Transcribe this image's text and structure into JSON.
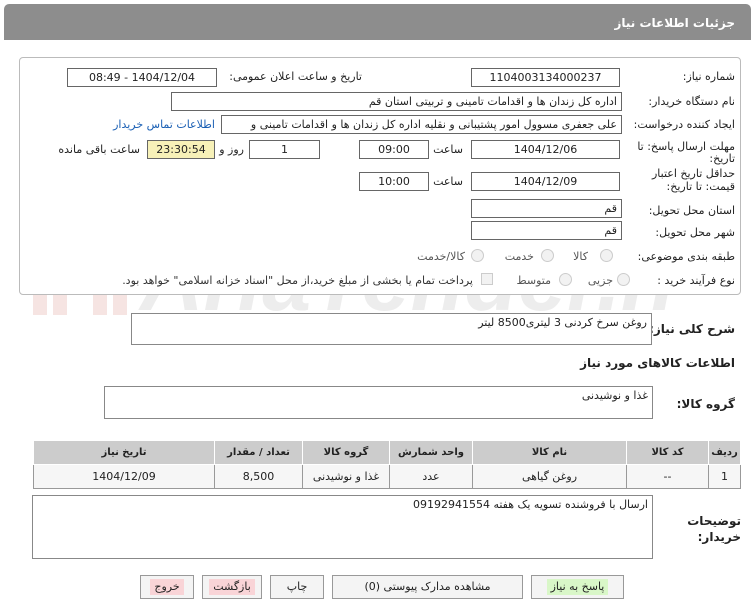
{
  "header": {
    "title": "جزئیات اطلاعات نیاز"
  },
  "form": {
    "need_number_label": "شماره نیاز:",
    "need_number": "1104003134000237",
    "announce_label": "تاریخ و ساعت اعلان عمومی:",
    "announce_value": "1404/12/04 - 08:49",
    "buyer_org_label": "نام دستگاه خریدار:",
    "buyer_org": "اداره کل زندان ها و اقدامات تامینی و تربیتی استان قم",
    "requester_label": "ایجاد کننده درخواست:",
    "requester": "علی جعفری مسوول امور پشتیبانی و نقلیه اداره کل زندان ها و اقدامات تامینی و",
    "contact_link": "اطلاعات تماس خریدار",
    "deadline_label_1": "مهلت ارسال پاسخ: تا",
    "deadline_label_2": "تاریخ:",
    "deadline_date": "1404/12/06",
    "time_label": "ساعت",
    "deadline_time": "09:00",
    "days_value": "1",
    "days_label": "روز و",
    "remaining_value": "23:30:54",
    "remaining_label": "ساعت باقی مانده",
    "validity_label_1": "حداقل تاریخ اعتبار",
    "validity_label_2": "قیمت: تا تاریخ:",
    "validity_date": "1404/12/09",
    "validity_time": "10:00",
    "province_label": "استان محل تحویل:",
    "province": "قم",
    "city_label": "شهر محل تحویل:",
    "city": "قم",
    "category_label": "طبقه بندی موضوعی:",
    "category_options": [
      "کالا",
      "خدمت",
      "کالا/خدمت"
    ],
    "process_label": "نوع فرآیند خرید :",
    "process_options": [
      "جزیی",
      "متوسط"
    ],
    "payment_note": "پرداخت تمام یا بخشی از مبلغ خرید،از محل \"اسناد خزانه اسلامی\" خواهد بود."
  },
  "description": {
    "label": "شرح کلی نیاز:",
    "value": "روغن سرخ کردنی 3 لیتری8500 لیتر"
  },
  "goods_section": {
    "title": "اطلاعات کالاهای مورد نیاز",
    "group_label": "گروه کالا:",
    "group_value": "غذا و نوشیدنی"
  },
  "table": {
    "headers": [
      "ردیف",
      "کد کالا",
      "نام کالا",
      "واحد شمارش",
      "گروه کالا",
      "تعداد / مقدار",
      "تاریخ نیاز"
    ],
    "rows": [
      [
        "1",
        "--",
        "روغن گیاهی",
        "عدد",
        "غذا و نوشیدنی",
        "8,500",
        "1404/12/09"
      ]
    ]
  },
  "buyer_notes": {
    "label_1": "توضیحات",
    "label_2": "خریدار:",
    "value": "ارسال با فروشنده تسویه یک هفته 09192941554"
  },
  "buttons": {
    "reply": "پاسخ به نیاز",
    "documents": "مشاهده مدارک پیوستی (0)",
    "print": "چاپ",
    "back": "بازگشت",
    "exit": "خروج"
  },
  "watermark": {
    "text": "AriaTender.neT"
  },
  "colors": {
    "header_bg": "#8d8d8d",
    "remaining_bg": "#f7f1b8",
    "link": "#1a5fb4",
    "reply_btn": "#d9f7c8",
    "exit_btn": "#f9d4d7"
  }
}
